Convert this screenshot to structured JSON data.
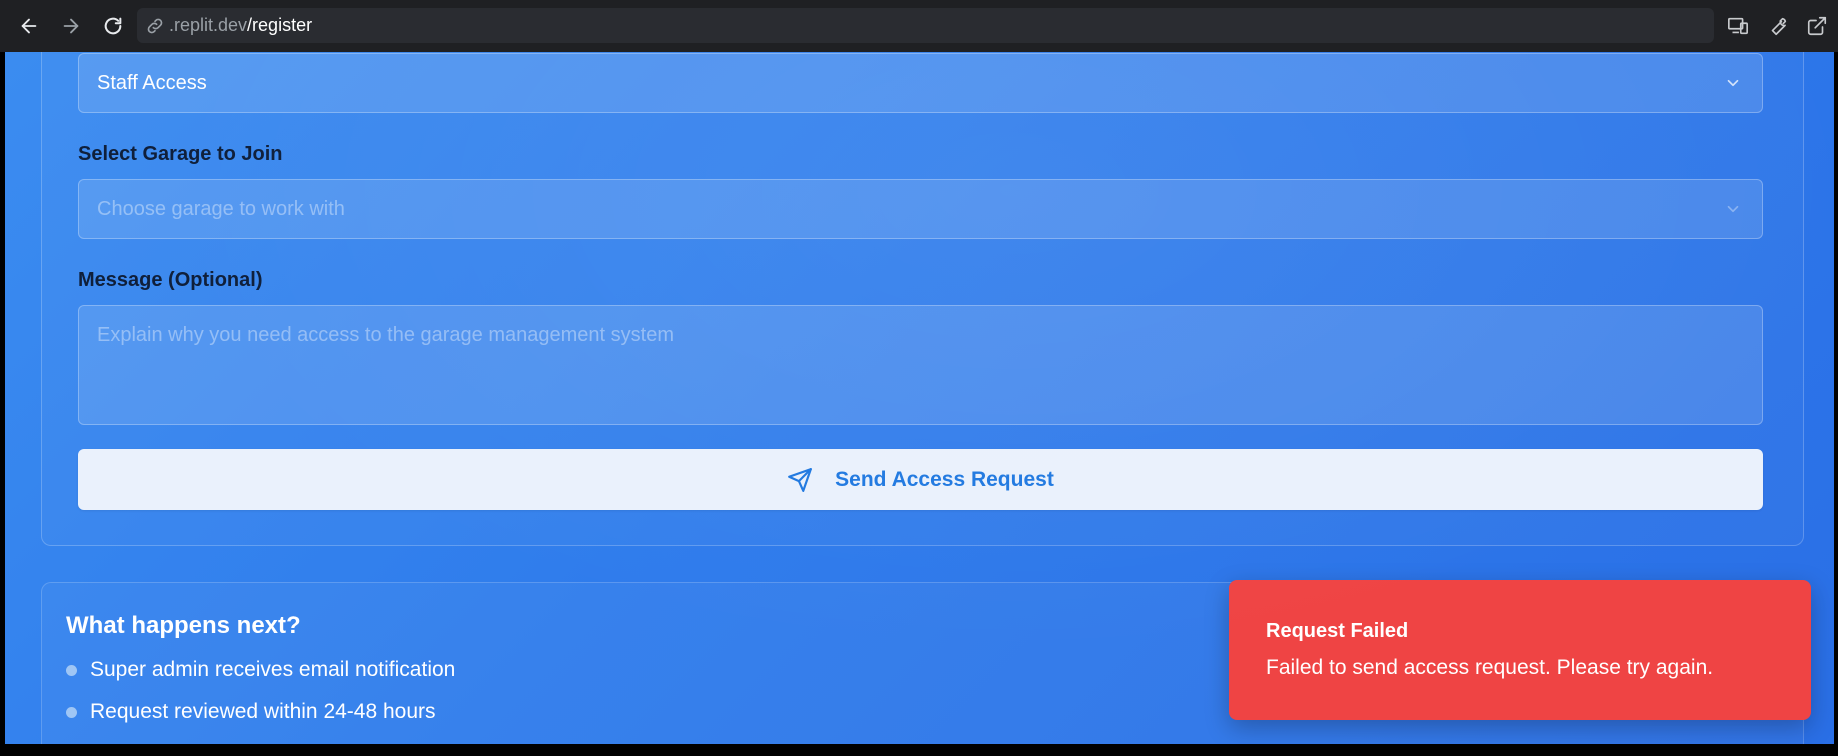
{
  "browser": {
    "url_domain": ".replit.dev",
    "url_path": "/register"
  },
  "form": {
    "access_type_value": "Staff Access",
    "garage_label": "Select Garage to Join",
    "garage_placeholder": "Choose garage to work with",
    "message_label": "Message (Optional)",
    "message_placeholder": "Explain why you need access to the garage management system",
    "send_label": "Send Access Request"
  },
  "info": {
    "title": "What happens next?",
    "items": [
      "Super admin receives email notification",
      "Request reviewed within 24-48 hours"
    ]
  },
  "toast": {
    "title": "Request Failed",
    "message": "Failed to send access request. Please try again."
  },
  "colors": {
    "accent": "#1f78e0",
    "error": "#ef4444",
    "background": "#2f7cec"
  }
}
